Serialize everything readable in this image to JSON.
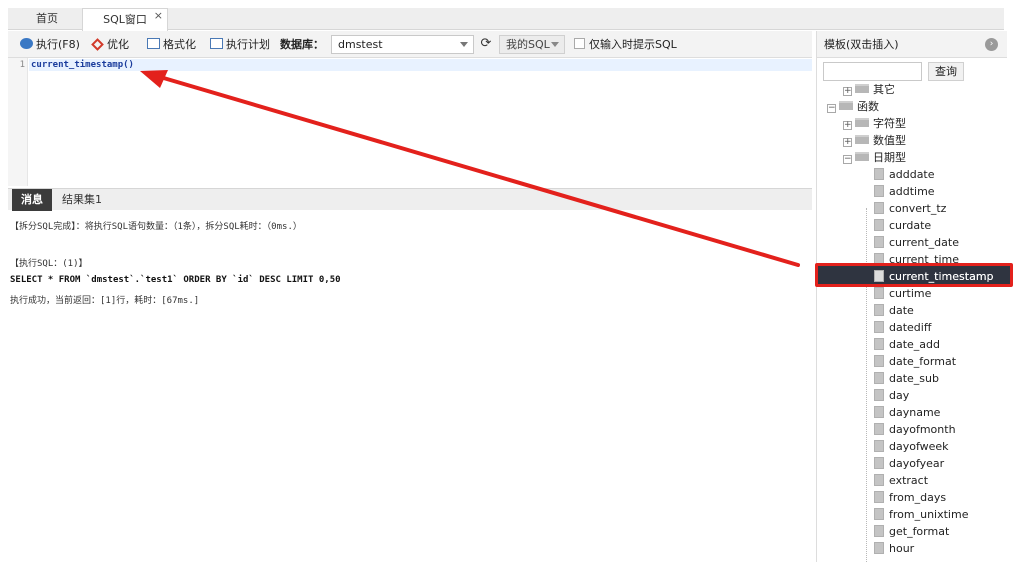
{
  "tabs": {
    "home": "首页",
    "sql_window": "SQL窗口",
    "close": "×"
  },
  "toolbar": {
    "run": "执行(F8)",
    "optimize": "优化",
    "format": "格式化",
    "plan": "执行计划",
    "database_label": "数据库：",
    "database_value": "dmstest",
    "my_sql": "我的SQL",
    "hint_checkbox": "仅输入时提示SQL"
  },
  "editor": {
    "line_number": "1",
    "code": "current_timestamp()"
  },
  "result_tabs": {
    "messages": "消息",
    "result_set": "结果集1"
  },
  "messages": [
    "【拆分SQL完成】：将执行SQL语句数量：（1条），拆分SQL耗时：（0ms.）",
    "【执行SQL：(1)】",
    "SELECT * FROM `dmstest`.`test1` ORDER BY `id` DESC  LIMIT 0,50",
    "执行成功，当前返回：[1]行，耗时：[67ms.]"
  ],
  "template_panel": {
    "title": "模板(双击插入)",
    "search_placeholder": "",
    "search_button": "查询",
    "tree": {
      "other": "其它",
      "functions": "函数",
      "string_type": "字符型",
      "numeric_type": "数值型",
      "date_type": "日期型",
      "date_functions": [
        "adddate",
        "addtime",
        "convert_tz",
        "curdate",
        "current_date",
        "current_time",
        "current_timestamp",
        "curtime",
        "date",
        "datediff",
        "date_add",
        "date_format",
        "date_sub",
        "day",
        "dayname",
        "dayofmonth",
        "dayofweek",
        "dayofyear",
        "extract",
        "from_days",
        "from_unixtime",
        "get_format",
        "hour"
      ],
      "selected": "current_timestamp"
    }
  },
  "colors": {
    "annotation": "#e3211c",
    "selection": "#2f3440",
    "code": "#1a3c9c"
  }
}
